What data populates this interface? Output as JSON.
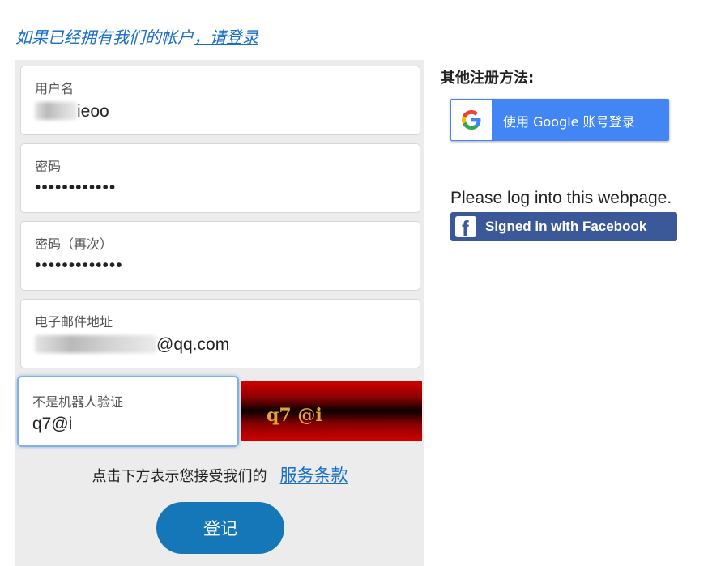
{
  "header": {
    "prompt_text": "如果已经拥有我们的帐户",
    "login_link": "，请登录"
  },
  "form": {
    "username": {
      "label": "用户名",
      "value_visible": "ieoo"
    },
    "password": {
      "label": "密码",
      "value": "••••••••••••"
    },
    "password_confirm": {
      "label": "密码（再次）",
      "value": "•••••••••••••"
    },
    "email": {
      "label": "电子邮件地址",
      "value_visible": "@qq.com"
    },
    "captcha": {
      "label": "不是机器人验证",
      "value": "q7@i",
      "image_text": "q7 @i"
    },
    "terms_text": "点击下方表示您接受我们的",
    "terms_link": "服务条款",
    "register_button": "登记"
  },
  "social": {
    "title": "其他注册方法:",
    "google_button": "使用 Google 账号登录",
    "facebook_prompt": "Please log into this webpage.",
    "facebook_button": "Signed in with Facebook"
  },
  "colors": {
    "link": "#1a6fc7",
    "primary_button": "#1677b8",
    "google_blue": "#4285f4",
    "facebook_blue": "#3b5998"
  },
  "icons": [
    "google-g-icon",
    "facebook-f-icon"
  ]
}
